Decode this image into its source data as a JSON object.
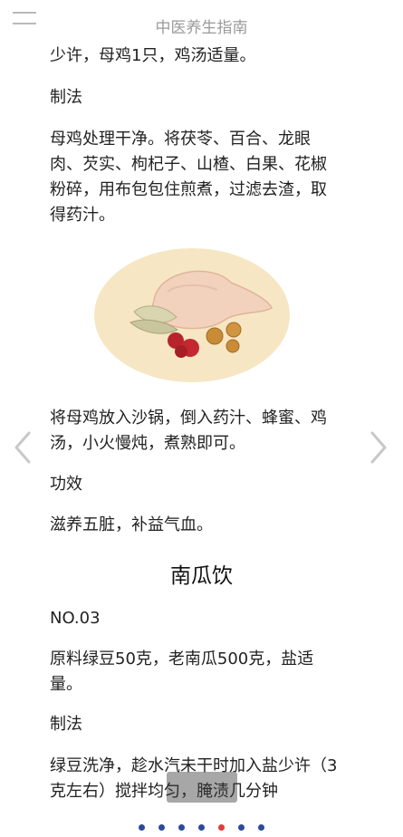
{
  "header": {
    "title": "中医养生指南"
  },
  "body": {
    "p1": "少许，母鸡1只，鸡汤适量。",
    "p2": "制法",
    "p3": "母鸡处理干净。将茯苓、百合、龙眼肉、芡实、枸杞子、山楂、白果、花椒粉碎，用布包包住煎煮，过滤去渣，取得药汁。",
    "p4": "将母鸡放入沙锅，倒入药汁、蜂蜜、鸡汤，小火慢炖，煮熟即可。",
    "p5": "功效",
    "p6": "滋养五脏，补益气血。",
    "recipe_title": "南瓜饮",
    "p7": "NO.03",
    "p8": "原料绿豆50克，老南瓜500克，盐适量。",
    "p9": "制法",
    "p10": "绿豆洗净，趁水汽未干时加入盐少许（3克左右）搅拌均匀，腌渍几分钟"
  },
  "pagination": {
    "count": 7,
    "active_index": 4
  },
  "icons": {
    "menu": "menu-icon",
    "prev": "chevron-left-icon",
    "next": "chevron-right-icon"
  },
  "colors": {
    "title": "#9a9a9a",
    "dot": "#2d4a9a",
    "dot_active": "#e23b3b",
    "plate": "#f7e6c3"
  }
}
